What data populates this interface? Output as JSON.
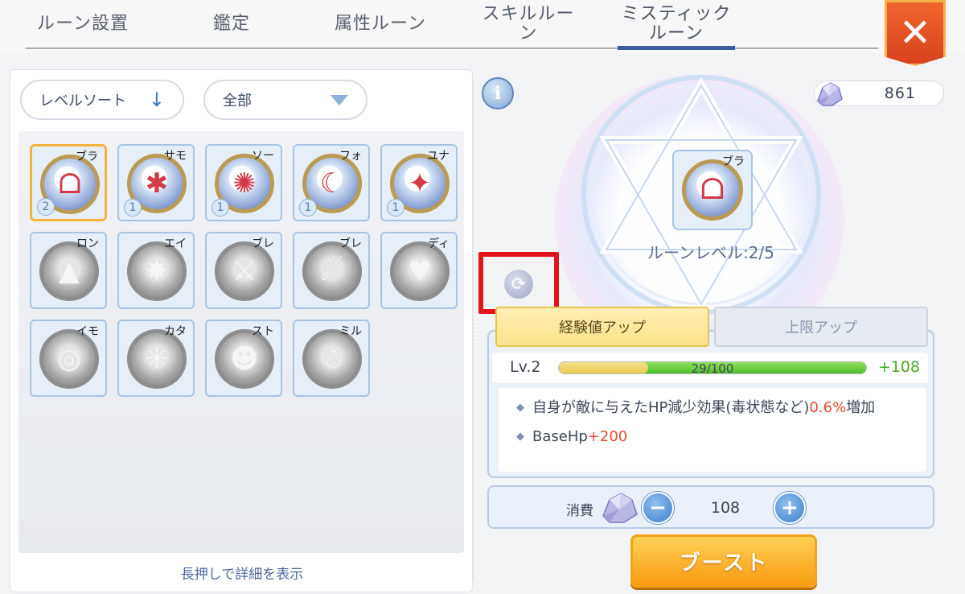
{
  "tabs": [
    {
      "label": "ルーン設置"
    },
    {
      "label": "鑑定"
    },
    {
      "label": "属性ルーン"
    },
    {
      "label": "スキルルーン"
    },
    {
      "label": "ミスティックルーン"
    }
  ],
  "close_label": "✕",
  "left": {
    "sort_label": "レベルソート",
    "sort_arrow": "↓",
    "filter_label": "全部",
    "hint": "長押しで詳細を表示",
    "runes": [
      {
        "name": "ブラ",
        "count": "2",
        "glyph": "ᗝ",
        "state": "colored",
        "selected": true
      },
      {
        "name": "サモ",
        "count": "1",
        "glyph": "✱",
        "state": "colored"
      },
      {
        "name": "ソー",
        "count": "1",
        "glyph": "✺",
        "state": "colored"
      },
      {
        "name": "フォ",
        "count": "1",
        "glyph": "☾",
        "state": "colored"
      },
      {
        "name": "ユナ",
        "count": "1",
        "glyph": "✦",
        "state": "colored"
      },
      {
        "name": "ロン",
        "glyph": "▲",
        "state": "gray"
      },
      {
        "name": "エイ",
        "glyph": "✸",
        "state": "gray"
      },
      {
        "name": "ブレ",
        "glyph": "⚔",
        "state": "gray"
      },
      {
        "name": "ブレ",
        "glyph": "☄",
        "state": "gray"
      },
      {
        "name": "ディ",
        "glyph": "♥",
        "state": "gray"
      },
      {
        "name": "イモ",
        "glyph": "◎",
        "state": "gray"
      },
      {
        "name": "カタ",
        "glyph": "✳",
        "state": "gray"
      },
      {
        "name": "スト",
        "glyph": "☻",
        "state": "gray"
      },
      {
        "name": "ミル",
        "glyph": "☃",
        "state": "gray"
      }
    ]
  },
  "right": {
    "info_label": "i",
    "currency_value": "861",
    "selected_rune_name": "ブラ",
    "selected_rune_glyph": "ᗝ",
    "rune_level": "ルーンレベル:2/5",
    "refresh_glyph": "⟳",
    "subtabs": {
      "exp_up": "経験値アップ",
      "limit_up": "上限アップ"
    },
    "level_label": "Lv.2",
    "exp_text": "29/100",
    "exp_fraction": 0.29,
    "exp_gain_fraction": 1.0,
    "exp_plus": "+108",
    "effects": [
      {
        "bullet": "◆",
        "text": "自身が敵に与えたHP減少効果(毒状態など)",
        "value": "0.6%",
        "suffix": "増加"
      },
      {
        "bullet": "◆",
        "text": "BaseHp",
        "value": "+200",
        "suffix": ""
      }
    ],
    "cost_label": "消費",
    "minus": "−",
    "plus": "+",
    "cost_value": "108",
    "boost_label": "ブースト"
  },
  "colors": {
    "accent": "#3f5f9b",
    "highlight_box": "#e0141b",
    "boost": "#f79b12",
    "exp_gain": "#4fbf2b",
    "value_red": "#ea4b32"
  }
}
